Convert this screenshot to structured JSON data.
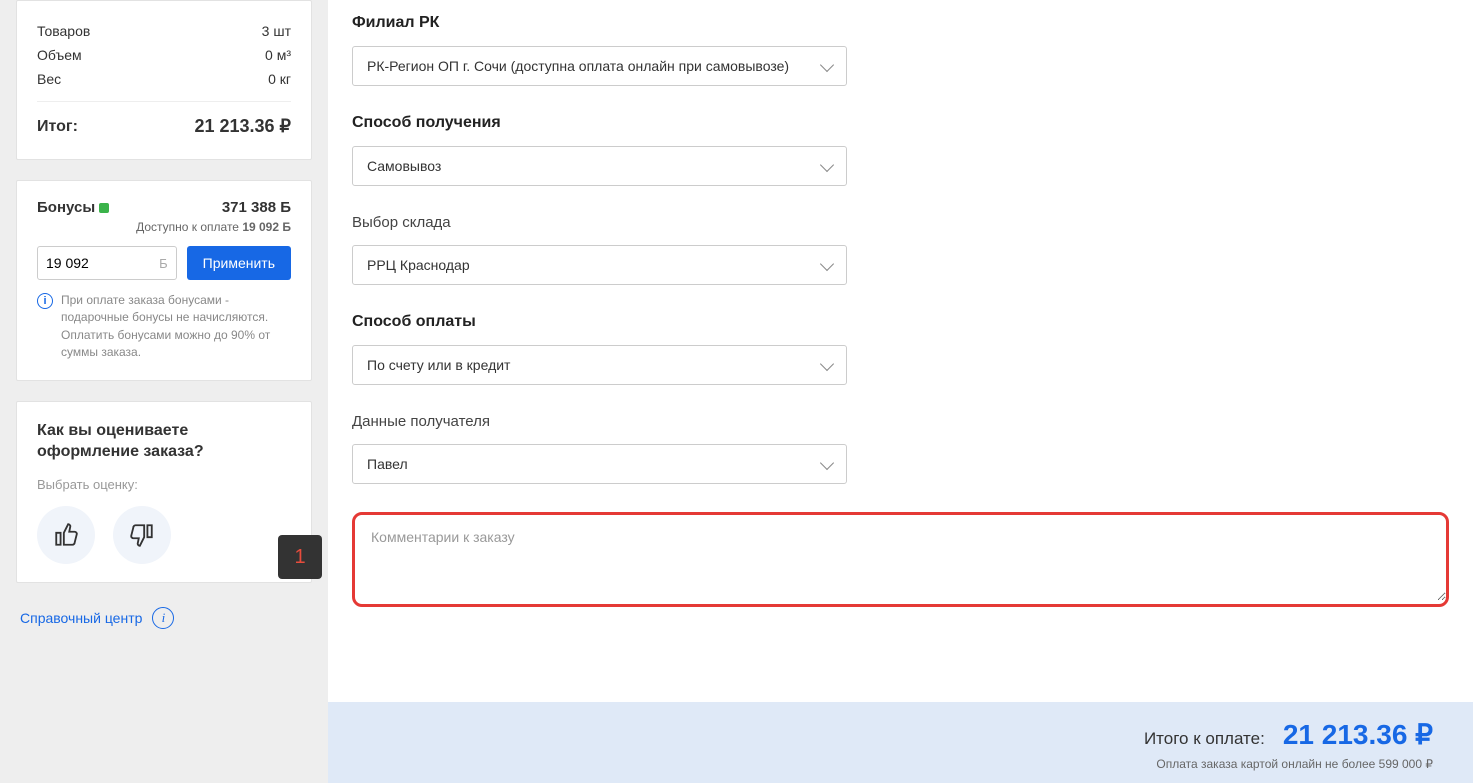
{
  "summary": {
    "goods_label": "Товаров",
    "goods_value": "3 шт",
    "volume_label": "Объем",
    "volume_value": "0 м³",
    "weight_label": "Вес",
    "weight_value": "0 кг",
    "total_label": "Итог:",
    "total_value": "21 213.36 ₽"
  },
  "bonuses": {
    "label": "Бонусы",
    "balance": "371 388 Б",
    "available_prefix": "Доступно к оплате ",
    "available_value": "19 092 Б",
    "input_value": "19 092",
    "input_unit": "Б",
    "apply_label": "Применить",
    "note": "При оплате заказа бонусами - подарочные бонусы не начисляются. Оплатить бонусами можно до 90% от суммы заказа."
  },
  "rating": {
    "title": "Как вы оцениваете оформление заказа?",
    "choose_label": "Выбрать оценку:"
  },
  "help_link": "Справочный центр",
  "form": {
    "branch": {
      "label": "Филиал РК",
      "value": "РК-Регион ОП г. Сочи (доступна оплата онлайн при самовывозе)"
    },
    "delivery": {
      "label": "Способ получения",
      "value": "Самовывоз"
    },
    "warehouse": {
      "label": "Выбор склада",
      "value": "РРЦ Краснодар"
    },
    "payment": {
      "label": "Способ оплаты",
      "value": "По счету или в кредит"
    },
    "recipient": {
      "label": "Данные получателя",
      "value": "Павел"
    },
    "comment_placeholder": "Комментарии к заказу"
  },
  "callout": "1",
  "footer": {
    "total_label": "Итого к оплате:",
    "total_value": "21 213.36 ₽",
    "note": "Оплата заказа картой онлайн не более 599 000 ₽"
  }
}
